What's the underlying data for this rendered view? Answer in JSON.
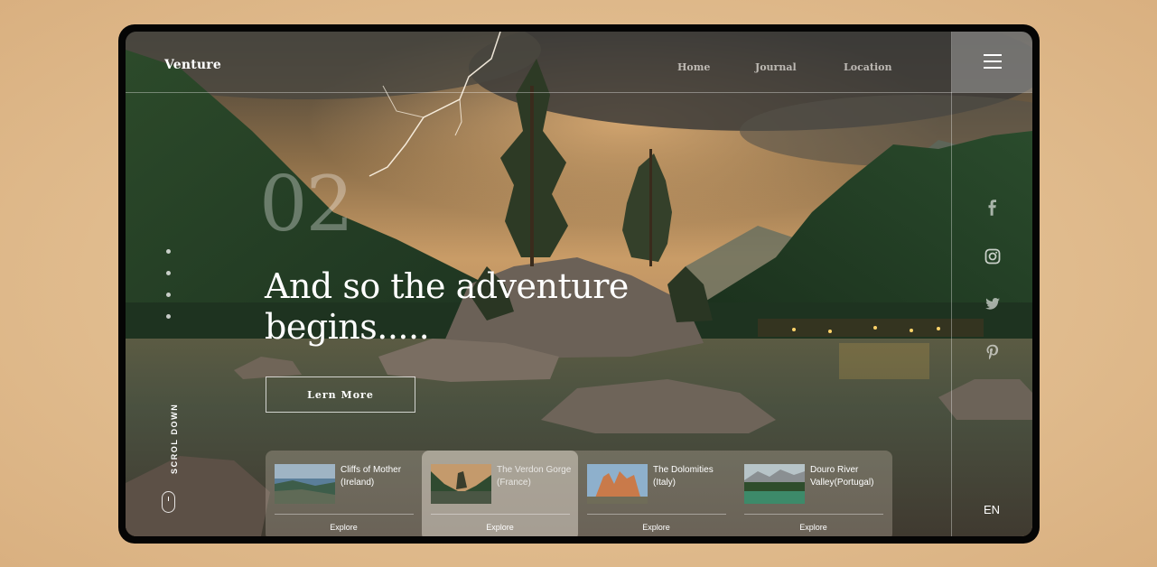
{
  "brand": "Venture",
  "nav": [
    "Home",
    "Journal",
    "Location"
  ],
  "slide_number": "02",
  "headline": "And so the adventure begins.....",
  "cta_label": "Lern More",
  "scroll_label": "SCROL DOWN",
  "language": "EN",
  "social_icons": [
    "facebook-icon",
    "instagram-icon",
    "twitter-icon",
    "pinterest-icon"
  ],
  "cards": [
    {
      "title": "Cliffs of Mother (Ireland)",
      "explore": "Explore"
    },
    {
      "title": "The Verdon Gorge (France)",
      "explore": "Explore"
    },
    {
      "title": "The Dolomities (Italy)",
      "explore": "Explore"
    },
    {
      "title": "Douro River Valley(Portugal)",
      "explore": "Explore"
    }
  ],
  "colors": {
    "page_background": "#e0bb8d",
    "frame": "#050505",
    "text": "#ffffff"
  }
}
